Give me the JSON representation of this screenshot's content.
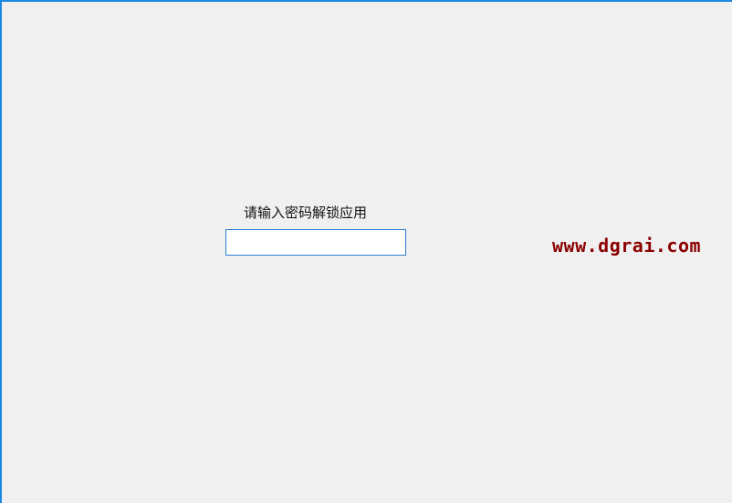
{
  "unlock_form": {
    "prompt": "请输入密码解锁应用",
    "password_value": ""
  },
  "watermark": {
    "text": "www.dgrai.com",
    "color": "#8b0000"
  },
  "colors": {
    "background": "#f0f0f0",
    "window_border": "#1e88e5",
    "input_border": "#2a7fd4"
  }
}
